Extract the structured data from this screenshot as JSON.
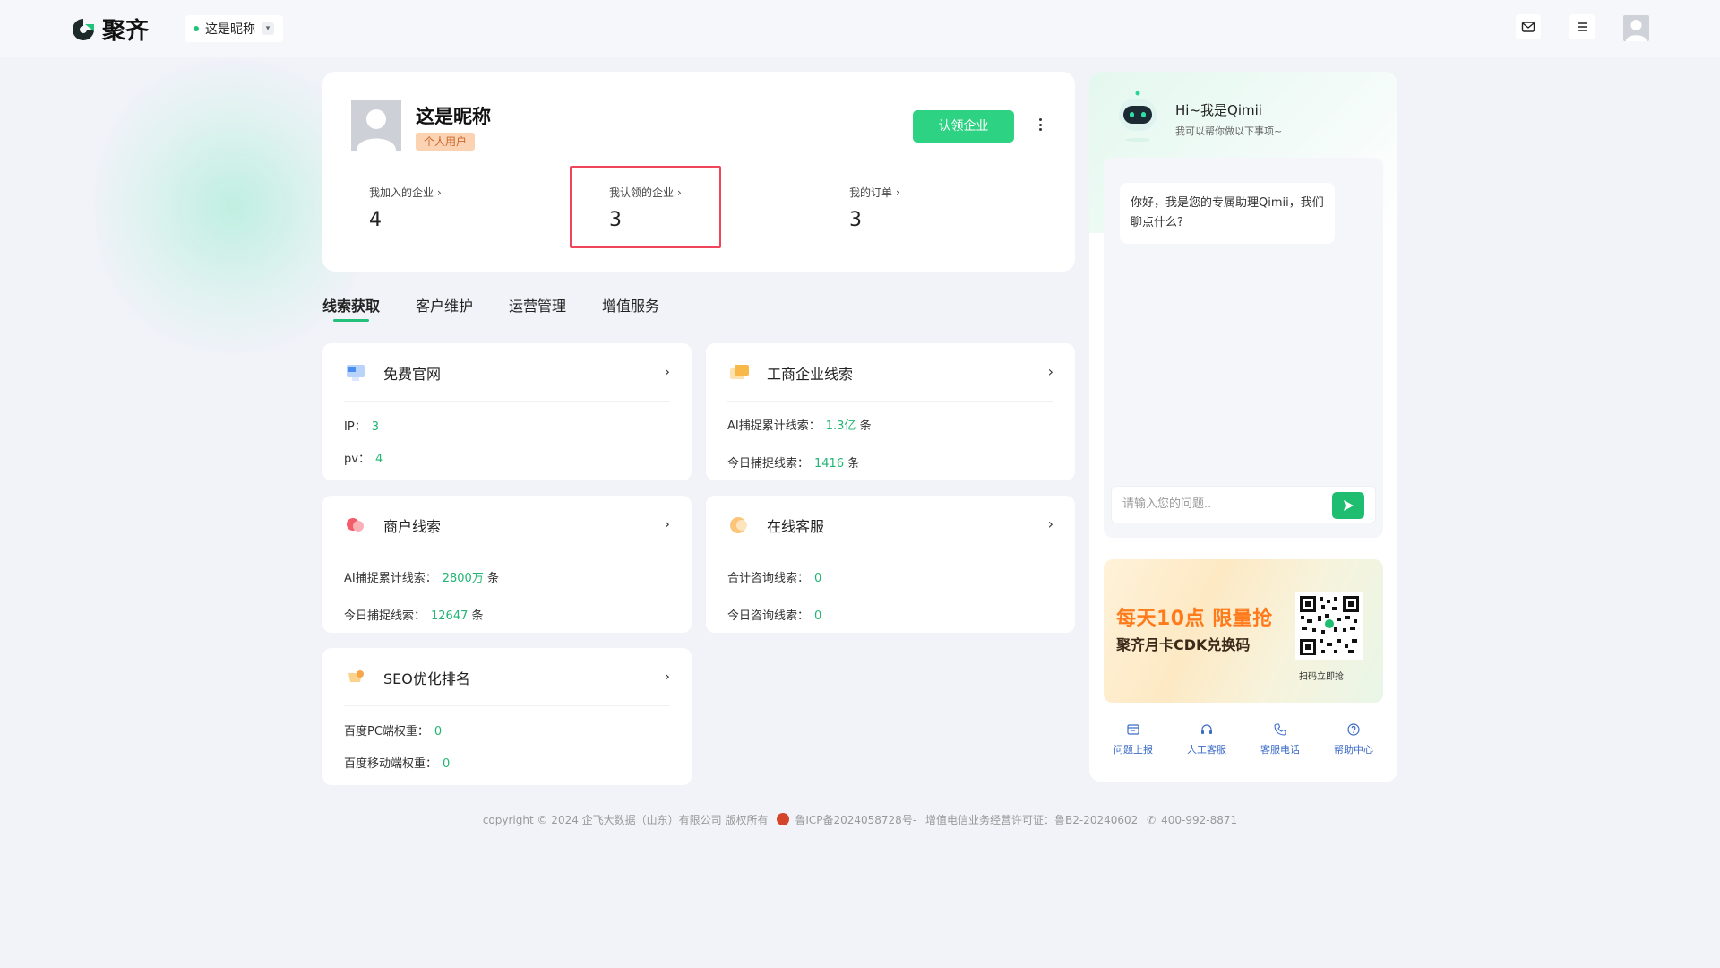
{
  "brand": {
    "name": "聚齐",
    "accent": "#21c27a"
  },
  "topbar": {
    "nickname": "这是昵称",
    "icons": [
      "mail-icon",
      "menu-icon",
      "user-avatar"
    ]
  },
  "profile": {
    "name": "这是昵称",
    "tag": "个人用户",
    "claim_button": "认领企业",
    "stats": [
      {
        "label": "我加入的企业",
        "value": "4"
      },
      {
        "label": "我认领的企业",
        "value": "3"
      },
      {
        "label": "我的订单",
        "value": "3"
      }
    ]
  },
  "tabs": [
    {
      "label": "线索获取",
      "active": true
    },
    {
      "label": "客户维护",
      "active": false
    },
    {
      "label": "运营管理",
      "active": false
    },
    {
      "label": "增值服务",
      "active": false
    }
  ],
  "cards": {
    "website": {
      "title": "免费官网",
      "rows": [
        {
          "label": "IP：",
          "value": "3",
          "unit": ""
        },
        {
          "label": "pv：",
          "value": "4",
          "unit": ""
        }
      ]
    },
    "business": {
      "title": "工商企业线索",
      "rows": [
        {
          "label": "AI捕捉累计线索：",
          "value": "1.3亿",
          "unit": "条"
        },
        {
          "label": "今日捕捉线索：",
          "value": "1416",
          "unit": "条"
        }
      ]
    },
    "merchant": {
      "title": "商户线索",
      "rows": [
        {
          "label": "AI捕捉累计线索：",
          "value": "2800万",
          "unit": "条"
        },
        {
          "label": "今日捕捉线索：",
          "value": "12647",
          "unit": "条"
        }
      ]
    },
    "service": {
      "title": "在线客服",
      "rows": [
        {
          "label": "合计咨询线索：",
          "value": "0",
          "unit": ""
        },
        {
          "label": "今日咨询线索：",
          "value": "0",
          "unit": ""
        }
      ]
    },
    "seo": {
      "title": "SEO优化排名",
      "rows": [
        {
          "label": "百度PC端权重：",
          "value": "0",
          "unit": ""
        },
        {
          "label": "百度移动端权重：",
          "value": "0",
          "unit": ""
        }
      ]
    }
  },
  "chat": {
    "greeting": "Hi~我是Qimii",
    "sub": "我可以帮你做以下事项~",
    "message": "你好，我是您的专属助理Qimii，我们聊点什么?",
    "input_placeholder": "请输入您的问题..",
    "promo": {
      "line1": "每天10点 限量抢",
      "line2": "聚齐月卡CDK兑换码",
      "qr_caption": "扫码立即抢"
    },
    "tools": [
      {
        "label": "问题上报",
        "icon": "report-icon"
      },
      {
        "label": "人工客服",
        "icon": "headset-icon"
      },
      {
        "label": "客服电话",
        "icon": "phone-icon"
      },
      {
        "label": "帮助中心",
        "icon": "help-icon"
      }
    ]
  },
  "footer": {
    "copyright": "copyright © 2024 企飞大数据（山东）有限公司 版权所有",
    "icp": "鲁ICP备2024058728号-",
    "license": "增值电信业务经营许可证：鲁B2-20240602",
    "phone": "400-992-8871"
  }
}
